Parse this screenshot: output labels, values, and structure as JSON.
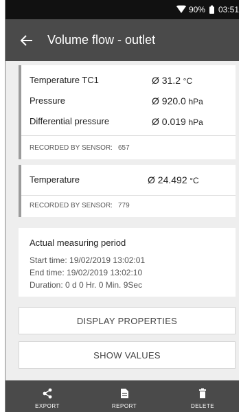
{
  "status_bar": {
    "battery": "90%",
    "time": "03:51"
  },
  "app_bar": {
    "title": "Volume flow - outlet"
  },
  "sensor_groups": [
    {
      "readings": [
        {
          "label": "Temperature TC1",
          "value": "Ø 31.2",
          "unit": "°C"
        },
        {
          "label": "Pressure",
          "value": "Ø 920.0",
          "unit": "hPa"
        },
        {
          "label": "Differential pressure",
          "value": "Ø 0.019",
          "unit": "hPa"
        }
      ],
      "recorded_label": "RECORDED BY SENSOR:",
      "sensor_id": "657"
    },
    {
      "readings": [
        {
          "label": "Temperature",
          "value": "Ø 24.492",
          "unit": "°C"
        }
      ],
      "recorded_label": "RECORDED BY SENSOR:",
      "sensor_id": "779"
    }
  ],
  "period": {
    "title": "Actual measuring period",
    "start": "Start time: 19/02/2019 13:02:01",
    "end": "End time: 19/02/2019 13:02:10",
    "duration": "Duration: 0 d 0 Hr. 0 Min. 9Sec"
  },
  "buttons": {
    "display_properties": "DISPLAY PROPERTIES",
    "show_values": "SHOW VALUES"
  },
  "bottom_nav": {
    "export": "EXPORT",
    "report": "REPORT",
    "delete": "DELETE"
  },
  "icons": {
    "wifi": "wifi-icon",
    "battery": "battery-icon",
    "back": "arrow-left-icon",
    "export": "share-icon",
    "report": "document-icon",
    "delete": "trash-icon"
  }
}
